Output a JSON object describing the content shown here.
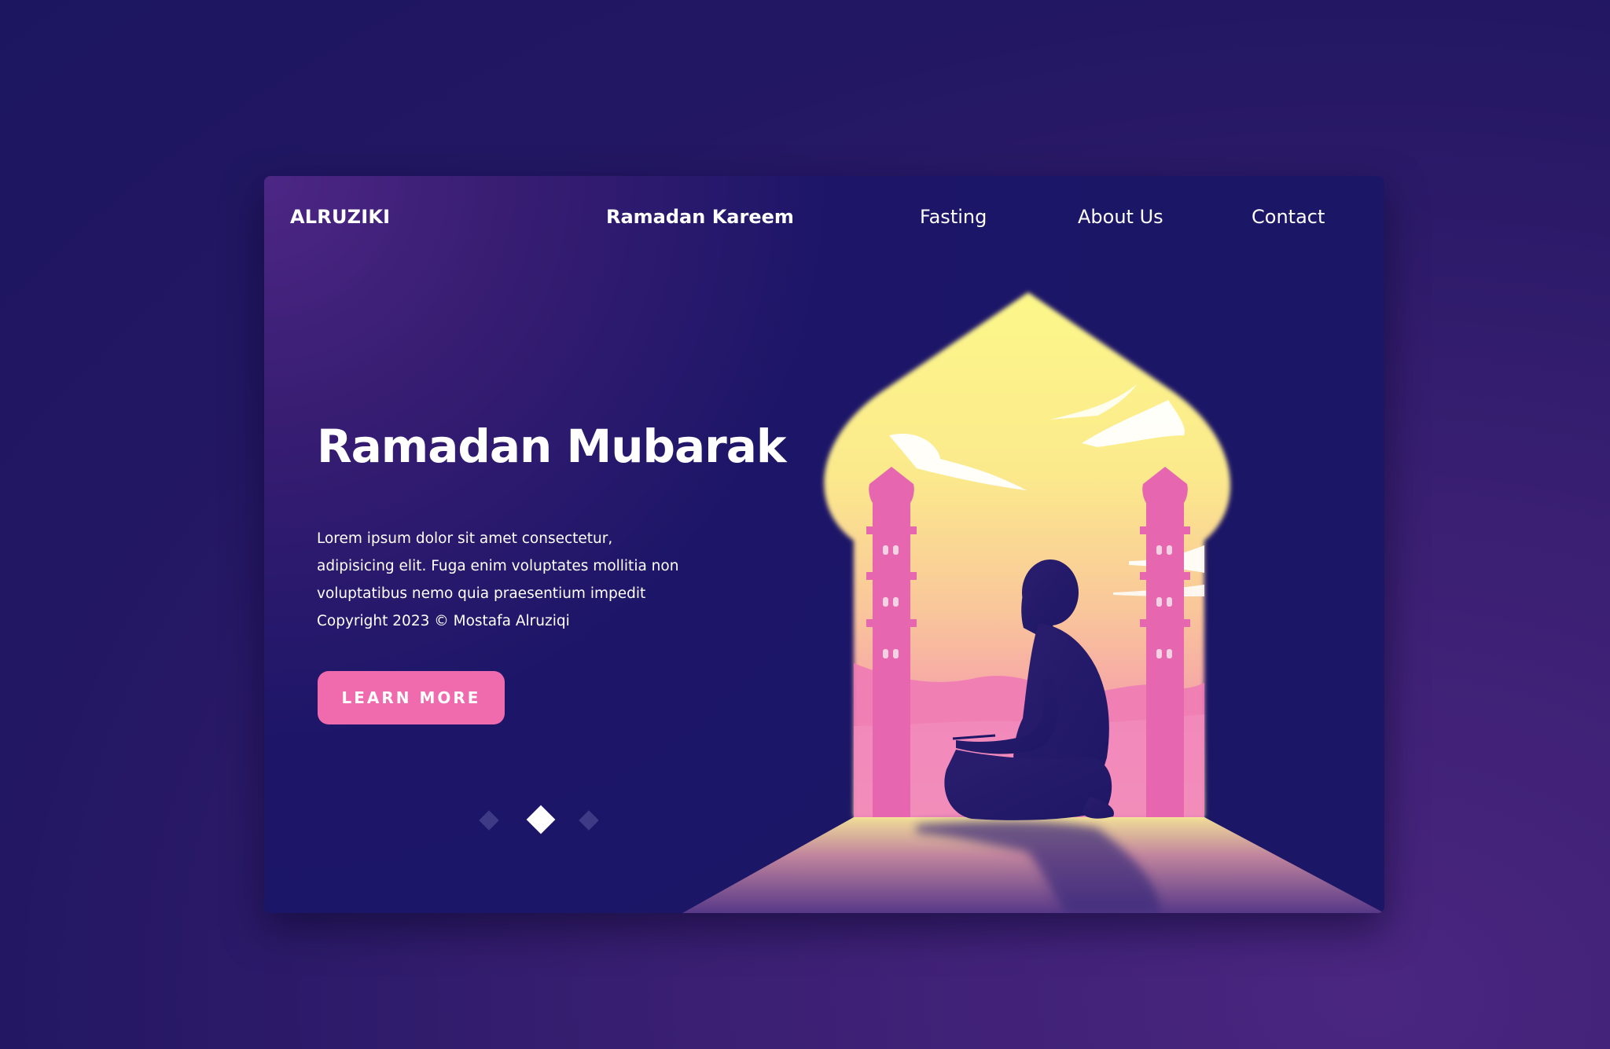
{
  "header": {
    "logo": "ALRUZIKI",
    "nav": [
      {
        "label": "Ramadan Kareem"
      },
      {
        "label": "Fasting"
      },
      {
        "label": "About Us"
      },
      {
        "label": "Contact"
      }
    ]
  },
  "hero": {
    "title": "Ramadan Mubarak",
    "paragraph_lines": [
      "Lorem ipsum dolor sit amet consectetur,",
      "adipisicing elit. Fuga enim voluptates mollitia non",
      "voluptatibus nemo quia praesentium impedit",
      "Copyright 2023 © Mostafa Alruziqi"
    ],
    "cta_label": "LEARN MORE"
  },
  "slider": {
    "count": 3,
    "active_index": 1
  },
  "colors": {
    "background": "#1c1660",
    "card": "#1b1666",
    "accent_pink": "#f06aae",
    "sky_yellow": "#fcf58a",
    "text": "#ffffff"
  }
}
